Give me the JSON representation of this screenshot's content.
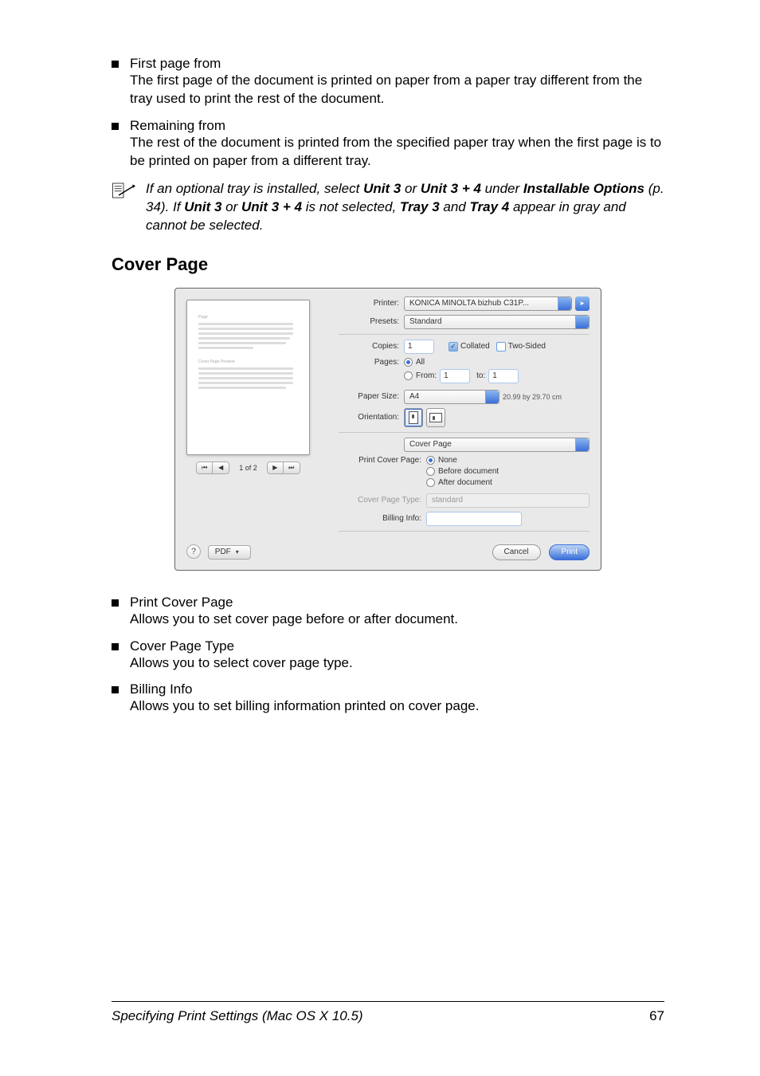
{
  "bullets_top": [
    {
      "title": "First page from",
      "desc": "The first page of the document is printed on paper from a paper tray different from the tray used to print the rest of the document."
    },
    {
      "title": "Remaining from",
      "desc": "The rest of the document is printed from the specified paper tray when the first page is to be printed on paper from a different tray."
    }
  ],
  "note_html": {
    "p1a": "If an optional tray is installed, select ",
    "b1": "Unit 3",
    "p1b": " or ",
    "b2": "Unit 3 + 4",
    "p1c": " under ",
    "b3": "Installable Options",
    "p2a": " (p. 34). If ",
    "b4": "Unit 3",
    "p2b": " or ",
    "b5": "Unit 3 + 4",
    "p2c": " is not selected, ",
    "b6": "Tray 3",
    "p3a": " and ",
    "b7": "Tray 4",
    "p3b": " appear in gray and cannot be selected."
  },
  "heading": "Cover Page",
  "dialog": {
    "printer_label": "Printer:",
    "printer_value": "KONICA MINOLTA bizhub C31P...",
    "presets_label": "Presets:",
    "presets_value": "Standard",
    "copies_label": "Copies:",
    "copies_value": "1",
    "collated_label": "Collated",
    "twosided_label": "Two-Sided",
    "pages_label": "Pages:",
    "pages_all": "All",
    "pages_from": "From:",
    "pages_from_val": "1",
    "pages_to": "to:",
    "pages_to_val": "1",
    "papersize_label": "Paper Size:",
    "papersize_value": "A4",
    "papersize_note": "20.99 by 29.70 cm",
    "orientation_label": "Orientation:",
    "section_value": "Cover Page",
    "pcp_label": "Print Cover Page:",
    "pcp_none": "None",
    "pcp_before": "Before document",
    "pcp_after": "After document",
    "cpt_label": "Cover Page Type:",
    "cpt_value": "standard",
    "billing_label": "Billing Info:",
    "billing_value": "",
    "nav_page": "1 of 2",
    "help": "?",
    "pdf": "PDF",
    "cancel": "Cancel",
    "print": "Print",
    "ext_arrow": "▸"
  },
  "bullets_bottom": [
    {
      "title": "Print Cover Page",
      "desc": "Allows you to set cover page before or after document."
    },
    {
      "title": "Cover Page Type",
      "desc": "Allows you to select cover page type."
    },
    {
      "title": "Billing Info",
      "desc": "Allows you to set billing information printed on cover page."
    }
  ],
  "footer": {
    "text": "Specifying Print Settings (Mac OS X 10.5)",
    "page": "67"
  }
}
